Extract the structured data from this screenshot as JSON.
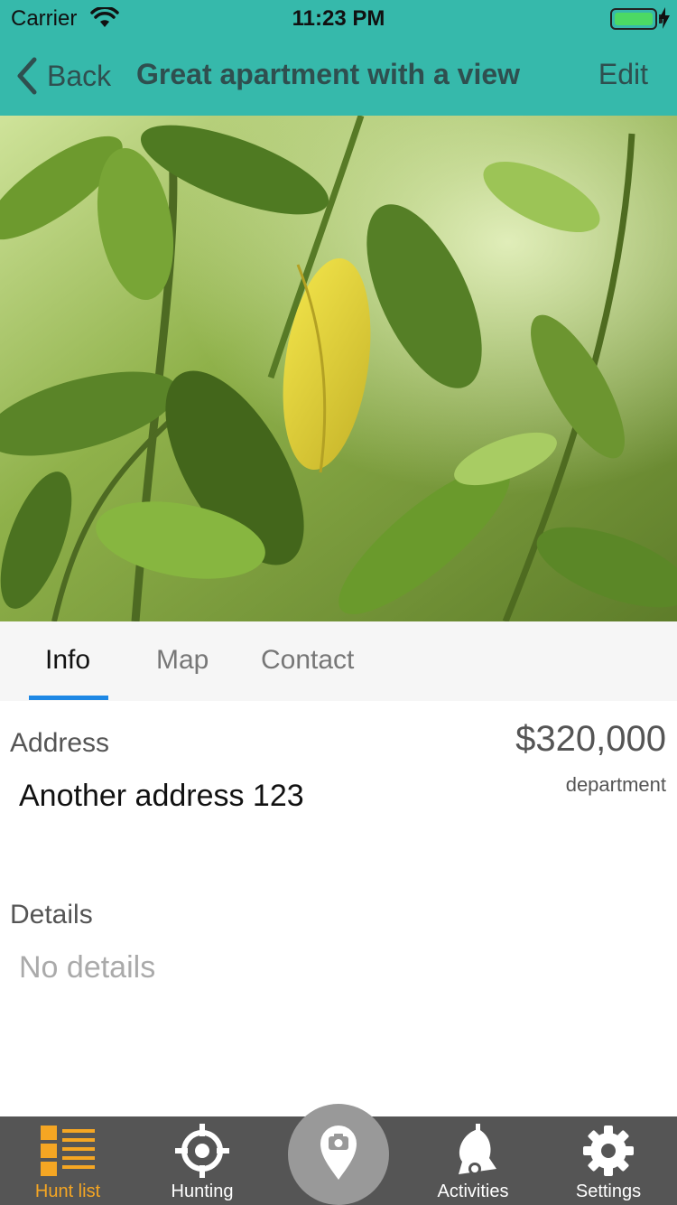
{
  "status": {
    "carrier": "Carrier",
    "time": "11:23 PM"
  },
  "nav": {
    "back_label": "Back",
    "title": "Great apartment with a view",
    "edit_label": "Edit"
  },
  "tabs": [
    {
      "label": "Info",
      "active": true
    },
    {
      "label": "Map",
      "active": false
    },
    {
      "label": "Contact",
      "active": false
    }
  ],
  "info": {
    "address_label": "Address",
    "address_value": "Another address 123",
    "price": "$320,000",
    "property_type": "department",
    "details_label": "Details",
    "details_value": "No details"
  },
  "tabbar": {
    "items": [
      {
        "label": "Hunt list",
        "icon": "hunt-list-icon",
        "active": true
      },
      {
        "label": "Hunting",
        "icon": "crosshair-icon",
        "active": false
      },
      {
        "label": "",
        "icon": "camera-pin-icon",
        "active": false
      },
      {
        "label": "Activities",
        "icon": "bell-icon",
        "active": false
      },
      {
        "label": "Settings",
        "icon": "gear-icon",
        "active": false
      }
    ]
  },
  "colors": {
    "header": "#36b9ab",
    "tab_indicator": "#1e88e5",
    "tabbar_bg": "#555555",
    "tabbar_active": "#f5a623"
  }
}
